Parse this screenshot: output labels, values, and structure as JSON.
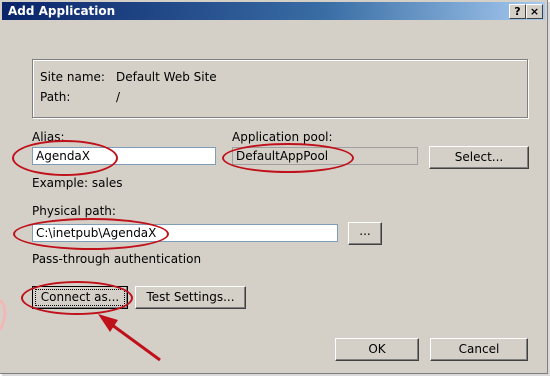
{
  "window": {
    "title": "Add Application",
    "help_button": "?",
    "close_button": "×"
  },
  "site": {
    "name_label": "Site name:",
    "name_value": "Default Web Site",
    "path_label": "Path:",
    "path_value": "/"
  },
  "alias": {
    "label": "Alias:",
    "value": "AgendaX",
    "example": "Example: sales"
  },
  "app_pool": {
    "label": "Application pool:",
    "value": "DefaultAppPool",
    "select_button": "Select..."
  },
  "physical_path": {
    "label": "Physical path:",
    "value": "C:\\inetpub\\AgendaX",
    "browse_button": "..."
  },
  "auth": {
    "label": "Pass-through authentication",
    "connect_as_button": "Connect as...",
    "test_settings_button": "Test Settings..."
  },
  "footer": {
    "ok_button": "OK",
    "cancel_button": "Cancel"
  },
  "annotation": {
    "highlight_color": "#c0101a"
  }
}
